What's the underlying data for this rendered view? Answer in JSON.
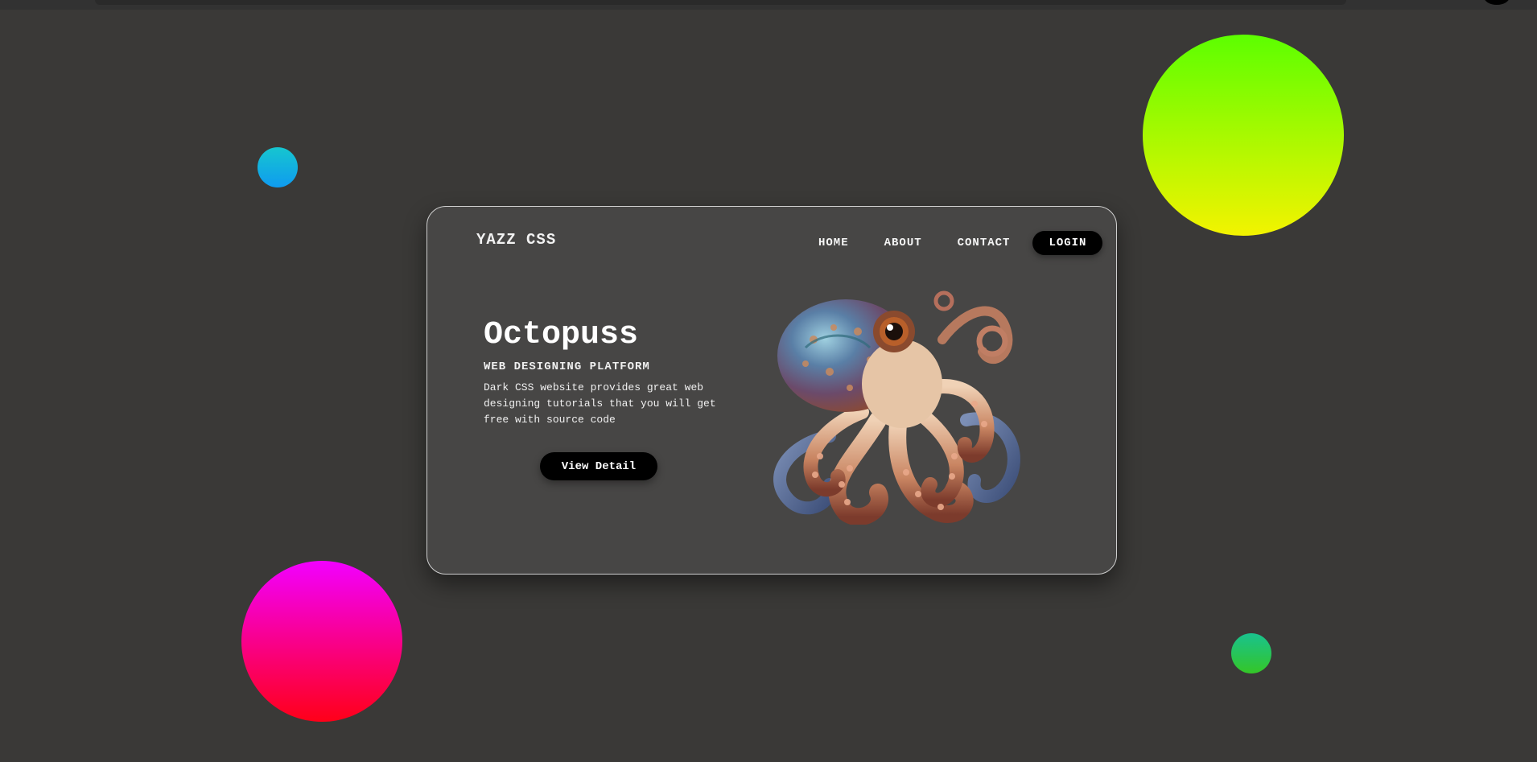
{
  "header": {
    "logo": "YAZZ CSS",
    "nav": [
      "HOME",
      "ABOUT",
      "CONTACT"
    ],
    "login_label": "LOGIN"
  },
  "hero": {
    "title": "Octopuss",
    "subtitle": "WEB DESIGNING PLATFORM",
    "description": "Dark CSS website provides great web designing tutorials that you will get free with source code",
    "cta_label": "View Detail"
  },
  "colors": {
    "background": "#3a3937",
    "card": "#474645",
    "button": "#000000",
    "blob_cyan": [
      "#16c6cf",
      "#0f9bf0"
    ],
    "blob_lime": [
      "#5cff00",
      "#f3f300"
    ],
    "blob_magenta": [
      "#f200ff",
      "#ff0018"
    ],
    "blob_green": [
      "#19c28e",
      "#34c627"
    ]
  },
  "illustration": {
    "name": "octopus-illustration"
  }
}
